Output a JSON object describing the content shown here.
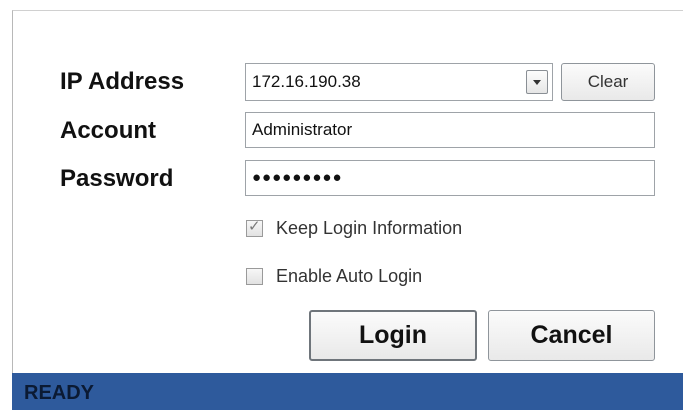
{
  "labels": {
    "ip_address": "IP Address",
    "account": "Account",
    "password": "Password"
  },
  "ip_combo": {
    "value": "172.16.190.38",
    "dropdown_icon": "chevron-down-icon"
  },
  "account": {
    "value": "Administrator"
  },
  "password": {
    "masked_value": "●●●●●●●●●"
  },
  "buttons": {
    "clear": "Clear",
    "login": "Login",
    "cancel": "Cancel"
  },
  "options": {
    "keep_login": {
      "label": "Keep Login Information",
      "checked": true
    },
    "auto_login": {
      "label": "Enable Auto Login",
      "checked": false
    }
  },
  "status": {
    "text": "READY",
    "color": "#2e5a9c"
  }
}
